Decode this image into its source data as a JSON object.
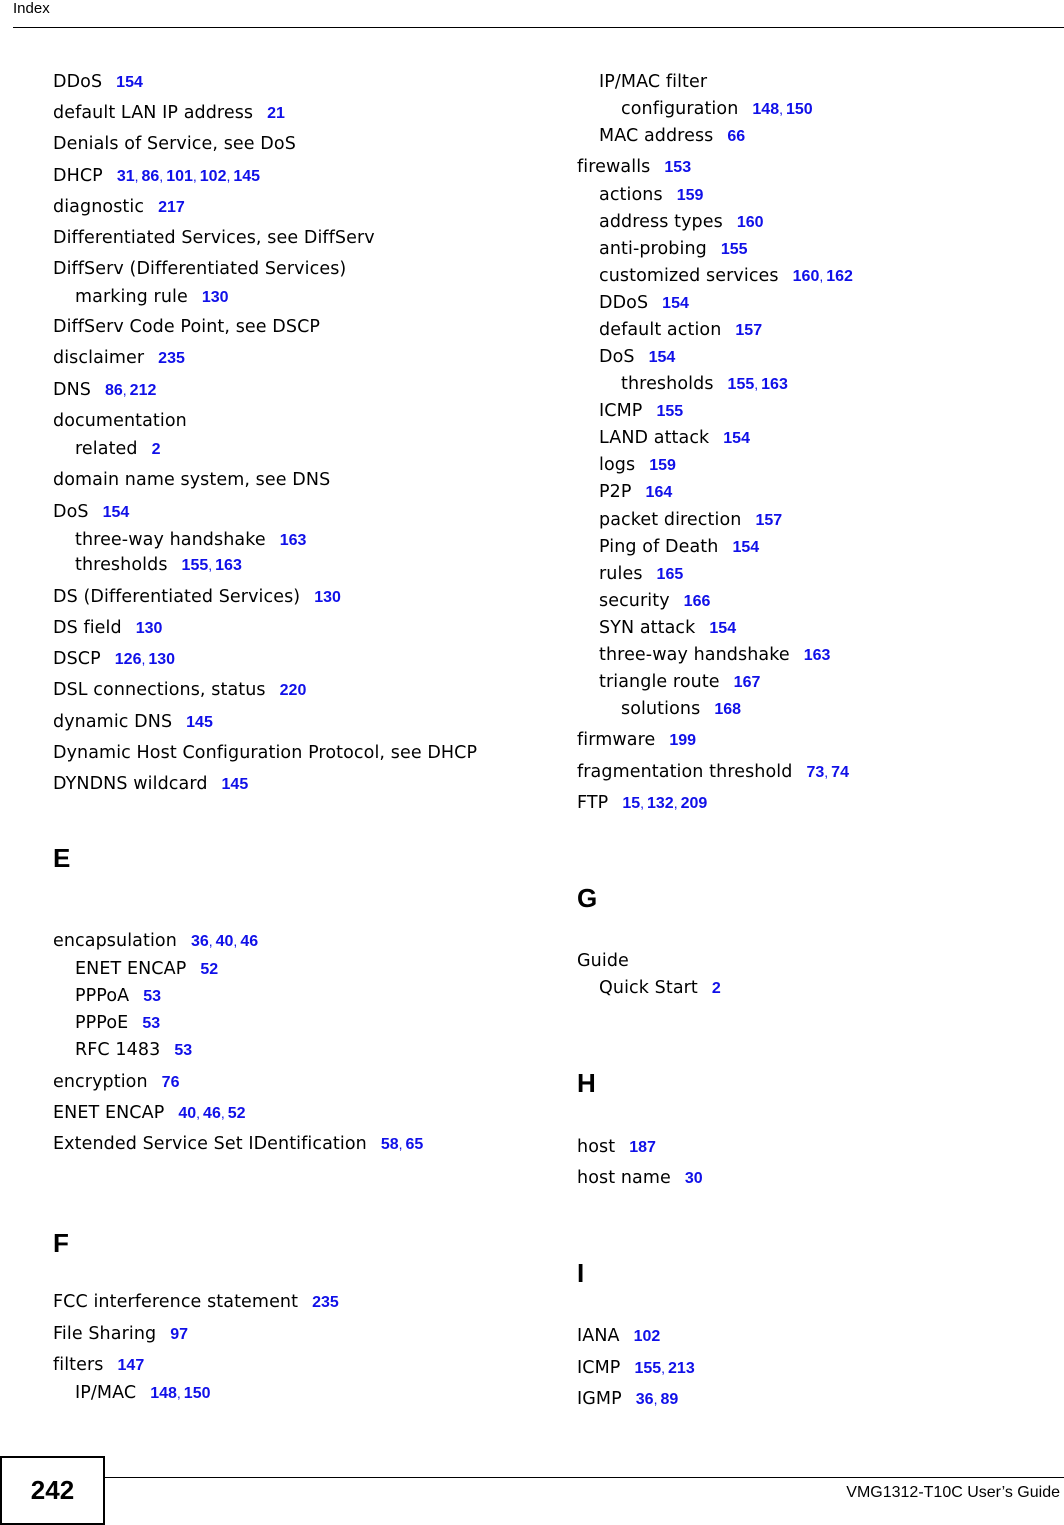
{
  "header": {
    "title": "Index"
  },
  "footer": {
    "page_number": "242",
    "guide_title": "VMG1312-T10C User’s Guide"
  },
  "colors": {
    "page_link": "#1010e8",
    "text": "#000000"
  },
  "left_column": [
    {
      "type": "entry",
      "level": 0,
      "term": "DDoS",
      "pages": [
        "154"
      ]
    },
    {
      "type": "entry",
      "level": 0,
      "term": "default LAN IP address",
      "pages": [
        "21"
      ]
    },
    {
      "type": "entry",
      "level": 0,
      "term": "Denials of Service, see DoS",
      "pages": []
    },
    {
      "type": "entry",
      "level": 0,
      "term": "DHCP",
      "pages": [
        "31",
        "86",
        "101",
        "102",
        "145"
      ]
    },
    {
      "type": "entry",
      "level": 0,
      "term": "diagnostic",
      "pages": [
        "217"
      ]
    },
    {
      "type": "entry",
      "level": 0,
      "term": "Differentiated Services, see DiffServ",
      "pages": []
    },
    {
      "type": "entry",
      "level": 0,
      "term": "DiffServ (Differentiated Services)",
      "pages": []
    },
    {
      "type": "entry",
      "level": 1,
      "term": "marking rule",
      "pages": [
        "130"
      ]
    },
    {
      "type": "entry",
      "level": 0,
      "term": "DiffServ Code Point, see DSCP",
      "pages": []
    },
    {
      "type": "entry",
      "level": 0,
      "term": "disclaimer",
      "pages": [
        "235"
      ]
    },
    {
      "type": "entry",
      "level": 0,
      "term": "DNS",
      "pages": [
        "86",
        "212"
      ]
    },
    {
      "type": "entry",
      "level": 0,
      "term": "documentation",
      "pages": []
    },
    {
      "type": "entry",
      "level": 1,
      "term": "related",
      "pages": [
        "2"
      ]
    },
    {
      "type": "entry",
      "level": 0,
      "term": "domain name system, see DNS",
      "pages": []
    },
    {
      "type": "entry",
      "level": 0,
      "term": "DoS",
      "pages": [
        "154"
      ]
    },
    {
      "type": "entry",
      "level": 1,
      "term": "three-way handshake",
      "pages": [
        "163"
      ]
    },
    {
      "type": "entry",
      "level": 1,
      "term": "thresholds",
      "pages": [
        "155",
        "163"
      ]
    },
    {
      "type": "entry",
      "level": 0,
      "term": "DS (Differentiated Services)",
      "pages": [
        "130"
      ]
    },
    {
      "type": "entry",
      "level": 0,
      "term": "DS field",
      "pages": [
        "130"
      ]
    },
    {
      "type": "entry",
      "level": 0,
      "term": "DSCP",
      "pages": [
        "126",
        "130"
      ]
    },
    {
      "type": "entry",
      "level": 0,
      "term": "DSL connections, status",
      "pages": [
        "220"
      ]
    },
    {
      "type": "entry",
      "level": 0,
      "term": "dynamic DNS",
      "pages": [
        "145"
      ]
    },
    {
      "type": "entry",
      "level": 0,
      "term": "Dynamic Host Configuration Protocol, see DHCP",
      "pages": []
    },
    {
      "type": "entry",
      "level": 0,
      "term": "DYNDNS wildcard",
      "pages": [
        "145"
      ]
    },
    {
      "type": "letter",
      "term": "E"
    },
    {
      "type": "entry",
      "level": 0,
      "term": "encapsulation",
      "pages": [
        "36",
        "40",
        "46"
      ]
    },
    {
      "type": "entry",
      "level": 1,
      "term": "ENET ENCAP",
      "pages": [
        "52"
      ]
    },
    {
      "type": "entry",
      "level": 1,
      "term": "PPPoA",
      "pages": [
        "53"
      ]
    },
    {
      "type": "entry",
      "level": 1,
      "term": "PPPoE",
      "pages": [
        "53"
      ]
    },
    {
      "type": "entry",
      "level": 1,
      "term": "RFC 1483",
      "pages": [
        "53"
      ]
    },
    {
      "type": "entry",
      "level": 0,
      "term": "encryption",
      "pages": [
        "76"
      ]
    },
    {
      "type": "entry",
      "level": 0,
      "term": "ENET ENCAP",
      "pages": [
        "40",
        "46",
        "52"
      ]
    },
    {
      "type": "entry",
      "level": 0,
      "term": "Extended Service Set IDentification",
      "pages": [
        "58",
        "65"
      ]
    },
    {
      "type": "letter",
      "term": "F"
    },
    {
      "type": "entry",
      "level": 0,
      "term": "FCC interference statement",
      "pages": [
        "235"
      ]
    },
    {
      "type": "entry",
      "level": 0,
      "term": "File Sharing",
      "pages": [
        "97"
      ]
    },
    {
      "type": "entry",
      "level": 0,
      "term": "filters",
      "pages": [
        "147"
      ]
    },
    {
      "type": "entry",
      "level": 1,
      "term": "IP/MAC",
      "pages": [
        "148",
        "150"
      ]
    }
  ],
  "right_column": [
    {
      "type": "entry",
      "level": 1,
      "term": "IP/MAC filter",
      "pages": []
    },
    {
      "type": "entry",
      "level": 2,
      "term": "configuration",
      "pages": [
        "148",
        "150"
      ]
    },
    {
      "type": "entry",
      "level": 1,
      "term": "MAC address",
      "pages": [
        "66"
      ]
    },
    {
      "type": "entry",
      "level": 0,
      "term": "firewalls",
      "pages": [
        "153"
      ]
    },
    {
      "type": "entry",
      "level": 1,
      "term": "actions",
      "pages": [
        "159"
      ]
    },
    {
      "type": "entry",
      "level": 1,
      "term": "address types",
      "pages": [
        "160"
      ]
    },
    {
      "type": "entry",
      "level": 1,
      "term": "anti-probing",
      "pages": [
        "155"
      ]
    },
    {
      "type": "entry",
      "level": 1,
      "term": "customized services",
      "pages": [
        "160",
        "162"
      ]
    },
    {
      "type": "entry",
      "level": 1,
      "term": "DDoS",
      "pages": [
        "154"
      ]
    },
    {
      "type": "entry",
      "level": 1,
      "term": "default action",
      "pages": [
        "157"
      ]
    },
    {
      "type": "entry",
      "level": 1,
      "term": "DoS",
      "pages": [
        "154"
      ]
    },
    {
      "type": "entry",
      "level": 2,
      "term": "thresholds",
      "pages": [
        "155",
        "163"
      ]
    },
    {
      "type": "entry",
      "level": 1,
      "term": "ICMP",
      "pages": [
        "155"
      ]
    },
    {
      "type": "entry",
      "level": 1,
      "term": "LAND attack",
      "pages": [
        "154"
      ]
    },
    {
      "type": "entry",
      "level": 1,
      "term": "logs",
      "pages": [
        "159"
      ]
    },
    {
      "type": "entry",
      "level": 1,
      "term": "P2P",
      "pages": [
        "164"
      ]
    },
    {
      "type": "entry",
      "level": 1,
      "term": "packet direction",
      "pages": [
        "157"
      ]
    },
    {
      "type": "entry",
      "level": 1,
      "term": "Ping of Death",
      "pages": [
        "154"
      ]
    },
    {
      "type": "entry",
      "level": 1,
      "term": "rules",
      "pages": [
        "165"
      ]
    },
    {
      "type": "entry",
      "level": 1,
      "term": "security",
      "pages": [
        "166"
      ]
    },
    {
      "type": "entry",
      "level": 1,
      "term": "SYN attack",
      "pages": [
        "154"
      ]
    },
    {
      "type": "entry",
      "level": 1,
      "term": "three-way handshake",
      "pages": [
        "163"
      ]
    },
    {
      "type": "entry",
      "level": 1,
      "term": "triangle route",
      "pages": [
        "167"
      ]
    },
    {
      "type": "entry",
      "level": 2,
      "term": "solutions",
      "pages": [
        "168"
      ]
    },
    {
      "type": "entry",
      "level": 0,
      "term": "firmware",
      "pages": [
        "199"
      ]
    },
    {
      "type": "entry",
      "level": 0,
      "term": "fragmentation threshold",
      "pages": [
        "73",
        "74"
      ]
    },
    {
      "type": "entry",
      "level": 0,
      "term": "FTP",
      "pages": [
        "15",
        "132",
        "209"
      ]
    },
    {
      "type": "letter",
      "term": "G"
    },
    {
      "type": "entry",
      "level": 0,
      "term": "Guide",
      "pages": []
    },
    {
      "type": "entry",
      "level": 1,
      "term": "Quick Start",
      "pages": [
        "2"
      ]
    },
    {
      "type": "letter",
      "term": "H"
    },
    {
      "type": "entry",
      "level": 0,
      "term": "host",
      "pages": [
        "187"
      ]
    },
    {
      "type": "entry",
      "level": 0,
      "term": "host name",
      "pages": [
        "30"
      ]
    },
    {
      "type": "letter",
      "term": "I"
    },
    {
      "type": "entry",
      "level": 0,
      "term": "IANA",
      "pages": [
        "102"
      ]
    },
    {
      "type": "entry",
      "level": 0,
      "term": "ICMP",
      "pages": [
        "155",
        "213"
      ]
    },
    {
      "type": "entry",
      "level": 0,
      "term": "IGMP",
      "pages": [
        "36",
        "89"
      ]
    }
  ]
}
